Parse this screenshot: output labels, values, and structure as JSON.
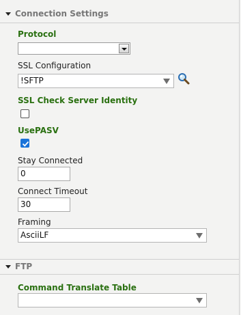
{
  "sections": {
    "connection": {
      "title": "Connection Settings"
    },
    "ftp": {
      "title": "FTP"
    }
  },
  "fields": {
    "protocol": {
      "label": "Protocol",
      "value": ""
    },
    "ssl_config": {
      "label": "SSL Configuration",
      "value": "!SFTP"
    },
    "ssl_check": {
      "label": "SSL Check Server Identity",
      "checked": false
    },
    "use_pasv": {
      "label": "UsePASV",
      "checked": true
    },
    "stay_connected": {
      "label": "Stay Connected",
      "value": "0"
    },
    "connect_timeout": {
      "label": "Connect Timeout",
      "value": "30"
    },
    "framing": {
      "label": "Framing",
      "value": "AsciiLF"
    },
    "command_translate": {
      "label": "Command Translate Table",
      "value": ""
    }
  },
  "icons": {
    "section_toggle": "triangle-down-icon",
    "lookup": "magnifier-icon",
    "check": "checkmark-icon"
  },
  "colors": {
    "required_label": "#2a7011",
    "section_header": "#777777",
    "checkbox_checked": "#1a73d9"
  }
}
